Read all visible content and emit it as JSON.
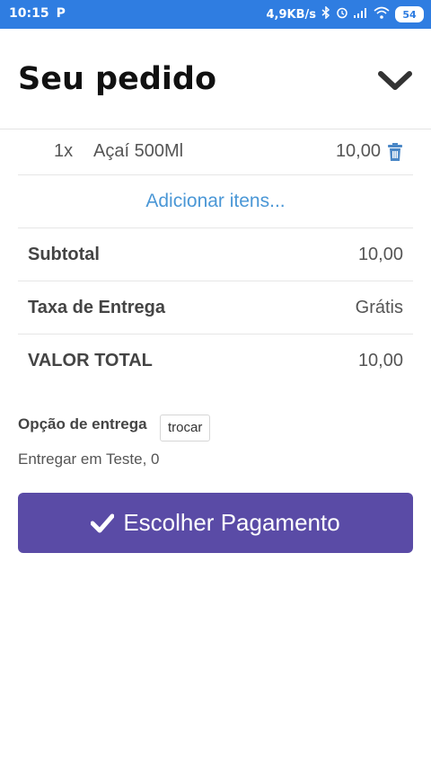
{
  "status_bar": {
    "time": "10:15",
    "app_badge": "P",
    "network_speed": "4,9KB/s",
    "battery": "54",
    "icons": [
      "bluetooth-icon",
      "alarm-icon",
      "signal-icon",
      "wifi-icon",
      "battery-icon"
    ]
  },
  "header": {
    "title": "Seu pedido",
    "collapse_icon": "chevron-down-icon"
  },
  "items": [
    {
      "qty": "1x",
      "name": "Açaí 500Ml",
      "price": "10,00",
      "delete_icon": "trash-icon"
    }
  ],
  "add_items_label": "Adicionar itens...",
  "summary": {
    "subtotal_label": "Subtotal",
    "subtotal_value": "10,00",
    "fee_label": "Taxa de Entrega",
    "fee_value": "Grátis",
    "total_label": "VALOR TOTAL",
    "total_value": "10,00"
  },
  "delivery": {
    "label": "Opção de entrega",
    "change_button": "trocar",
    "address": "Entregar em Teste, 0"
  },
  "payment_button": {
    "label": "Escolher Pagamento",
    "icon": "check-icon"
  },
  "colors": {
    "status_bar": "#2f7de1",
    "link": "#4a97d6",
    "trash_icon": "#4a87c6",
    "primary_button": "#5a4ba6"
  }
}
